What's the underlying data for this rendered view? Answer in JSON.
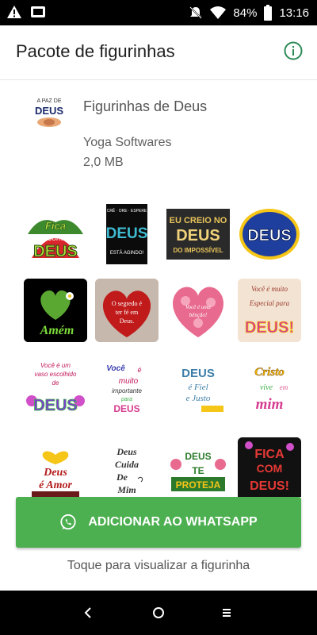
{
  "status_bar": {
    "battery": "84%",
    "time": "13:16",
    "icons": [
      "alert-icon",
      "photo-icon",
      "mute-icon",
      "wifi-icon",
      "battery-icon"
    ]
  },
  "header": {
    "title": "Pacote de figurinhas",
    "info_icon": "info-icon"
  },
  "pack": {
    "tray_text": [
      "A PAZ DE",
      "DEUS"
    ],
    "name": "Figurinhas de Deus",
    "publisher": "Yoga Softwares",
    "size": "2,0 MB"
  },
  "stickers": [
    {
      "text": "Fica com DEUS"
    },
    {
      "text": "DEUS ESTÁ AGINDO!"
    },
    {
      "text": "EU CREIO NO DEUS DO IMPOSSÍVEL"
    },
    {
      "text": "DEUS"
    },
    {
      "text": "Amém"
    },
    {
      "text": "O segredo é ter fé em Deus."
    },
    {
      "text": "Você é uma bênção!"
    },
    {
      "text": "Você é muito Especial para DEUS!"
    },
    {
      "text": "Você é um vaso escolhido de DEUS"
    },
    {
      "text": "Você é muito importante para DEUS"
    },
    {
      "text": "DEUS é Fiel e Justo"
    },
    {
      "text": "Cristo vive em mim"
    },
    {
      "text": "Deus é Amor"
    },
    {
      "text": "Deus Cuida De Mim"
    },
    {
      "text": "DEUS TE PROTEJA"
    },
    {
      "text": "FICA COM DEUS!"
    }
  ],
  "add_button": {
    "label": "ADICIONAR AO WHATSAPP",
    "icon": "whatsapp-icon"
  },
  "hint": "Toque para visualizar a figurinha",
  "nav": {
    "back": "back-icon",
    "home": "home-icon",
    "recents": "recents-icon"
  },
  "colors": {
    "accent": "#4caf50",
    "info": "#2e8b57"
  }
}
